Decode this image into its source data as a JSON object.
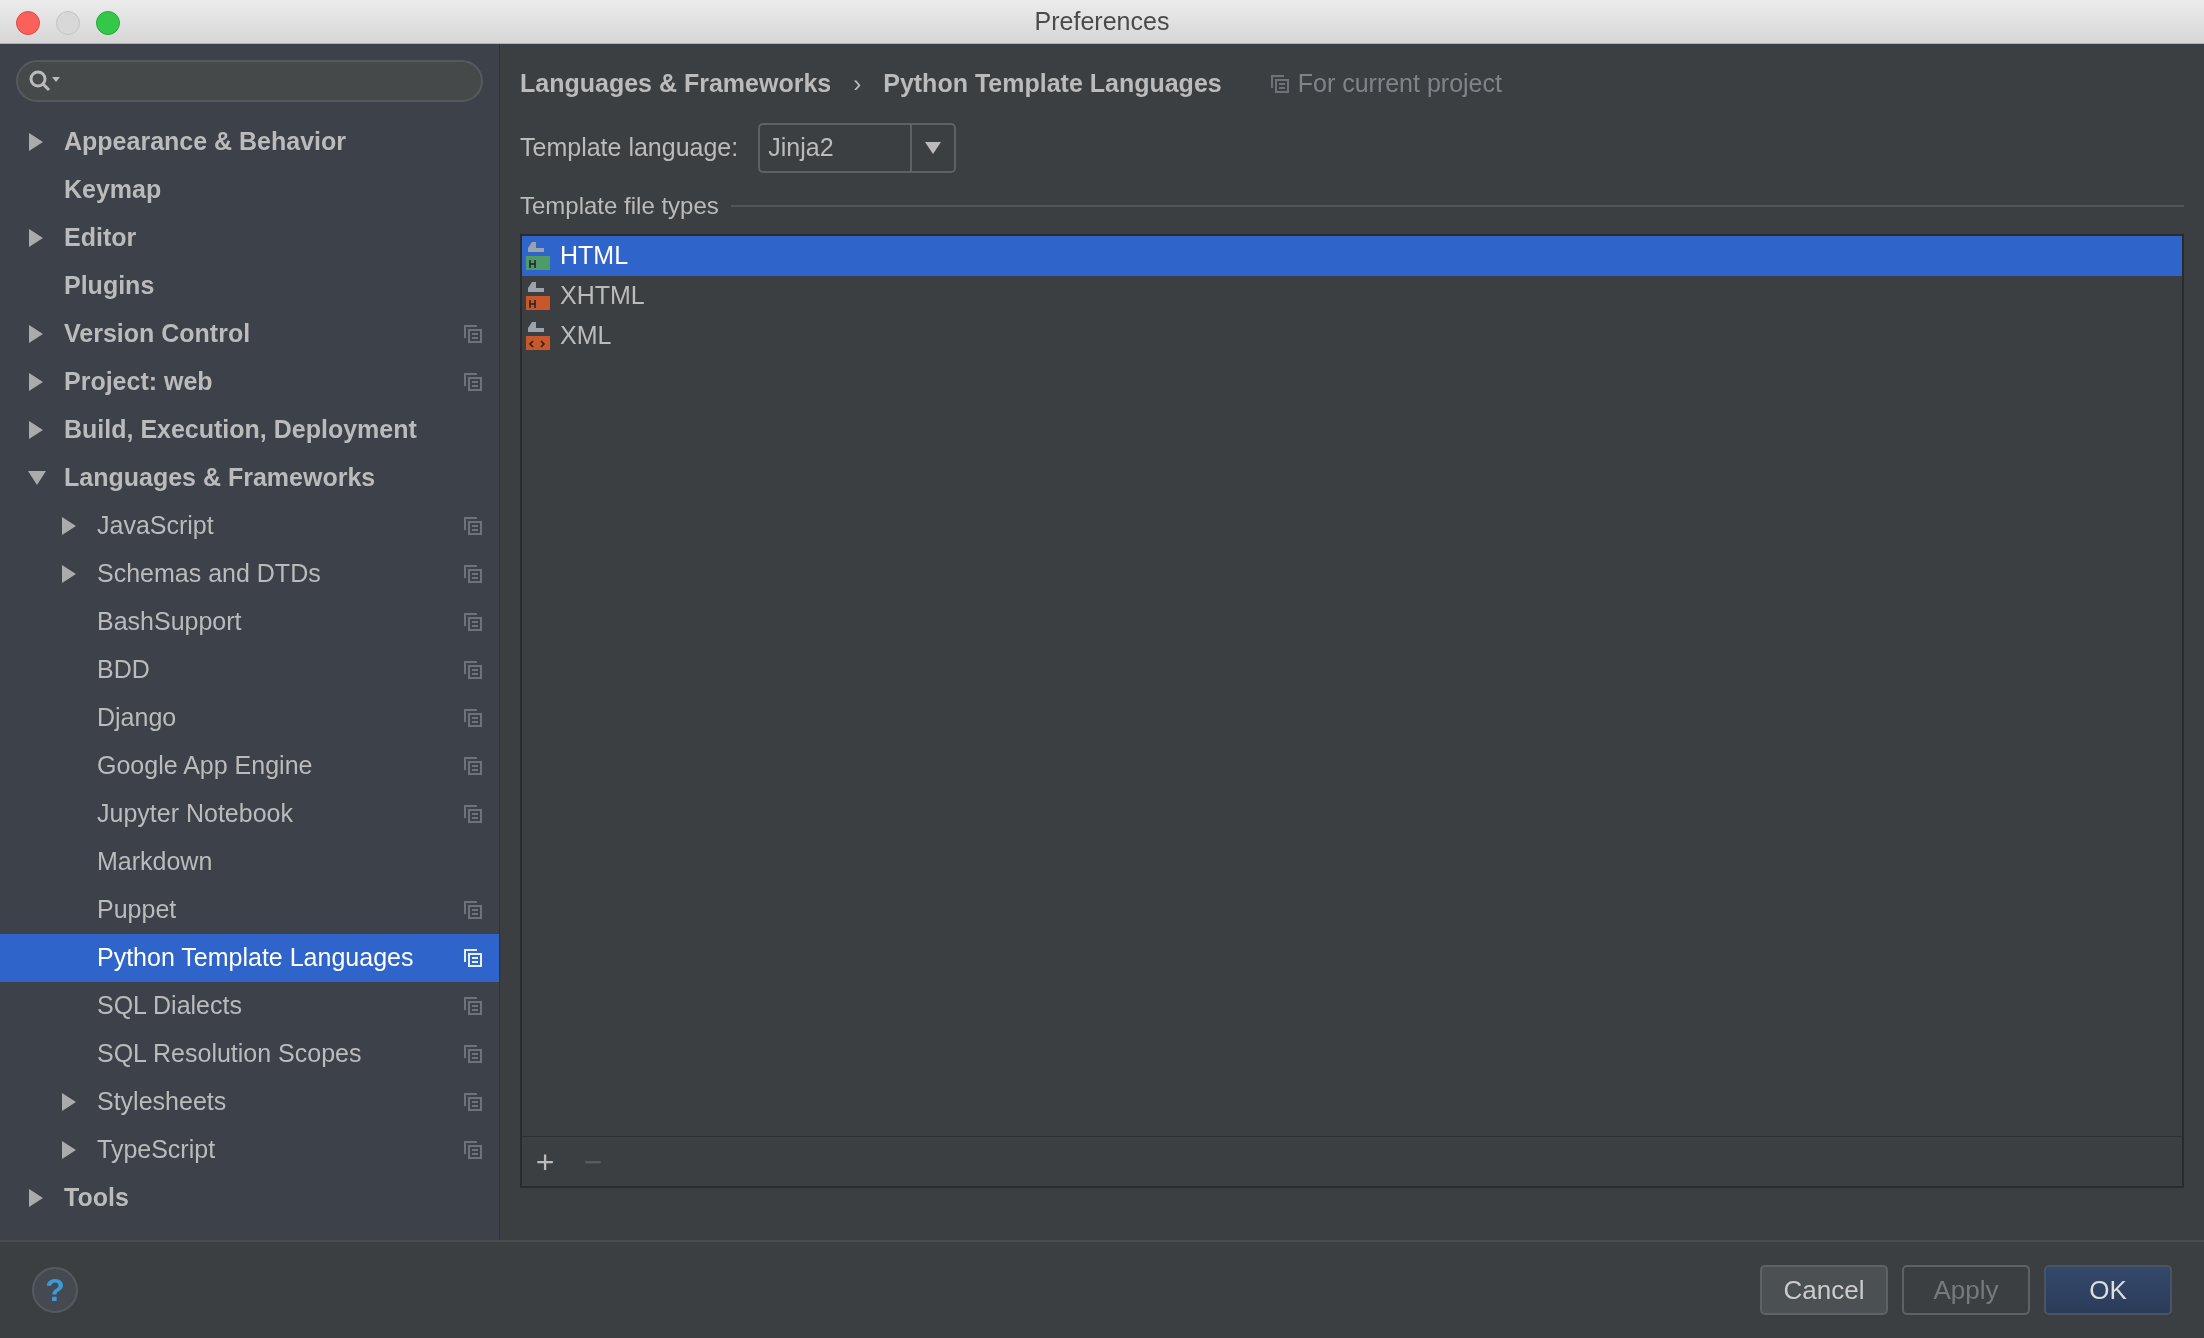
{
  "window": {
    "title": "Preferences"
  },
  "sidebar": {
    "items": [
      {
        "label": "Appearance & Behavior",
        "kind": "collapsed",
        "project_scope": false,
        "selected": false
      },
      {
        "label": "Keymap",
        "kind": "leaf",
        "project_scope": false,
        "selected": false
      },
      {
        "label": "Editor",
        "kind": "collapsed",
        "project_scope": false,
        "selected": false
      },
      {
        "label": "Plugins",
        "kind": "leaf",
        "project_scope": false,
        "selected": false
      },
      {
        "label": "Version Control",
        "kind": "collapsed",
        "project_scope": true,
        "selected": false
      },
      {
        "label": "Project: web",
        "kind": "collapsed",
        "project_scope": true,
        "selected": false
      },
      {
        "label": "Build, Execution, Deployment",
        "kind": "collapsed",
        "project_scope": false,
        "selected": false
      },
      {
        "label": "Languages & Frameworks",
        "kind": "expanded",
        "project_scope": false,
        "selected": false,
        "children": [
          {
            "label": "JavaScript",
            "kind": "collapsed",
            "project_scope": true,
            "selected": false
          },
          {
            "label": "Schemas and DTDs",
            "kind": "collapsed",
            "project_scope": true,
            "selected": false
          },
          {
            "label": "BashSupport",
            "kind": "leaf",
            "project_scope": true,
            "selected": false
          },
          {
            "label": "BDD",
            "kind": "leaf",
            "project_scope": true,
            "selected": false
          },
          {
            "label": "Django",
            "kind": "leaf",
            "project_scope": true,
            "selected": false
          },
          {
            "label": "Google App Engine",
            "kind": "leaf",
            "project_scope": true,
            "selected": false
          },
          {
            "label": "Jupyter Notebook",
            "kind": "leaf",
            "project_scope": true,
            "selected": false
          },
          {
            "label": "Markdown",
            "kind": "leaf",
            "project_scope": false,
            "selected": false
          },
          {
            "label": "Puppet",
            "kind": "leaf",
            "project_scope": true,
            "selected": false
          },
          {
            "label": "Python Template Languages",
            "kind": "leaf",
            "project_scope": true,
            "selected": true
          },
          {
            "label": "SQL Dialects",
            "kind": "leaf",
            "project_scope": true,
            "selected": false
          },
          {
            "label": "SQL Resolution Scopes",
            "kind": "leaf",
            "project_scope": true,
            "selected": false
          },
          {
            "label": "Stylesheets",
            "kind": "collapsed",
            "project_scope": true,
            "selected": false
          },
          {
            "label": "TypeScript",
            "kind": "collapsed",
            "project_scope": true,
            "selected": false
          }
        ]
      },
      {
        "label": "Tools",
        "kind": "collapsed",
        "project_scope": false,
        "selected": false
      }
    ]
  },
  "breadcrumbs": {
    "items": [
      "Languages & Frameworks",
      "Python Template Languages"
    ],
    "separator": "›",
    "scope": "For current project"
  },
  "template_language": {
    "label": "Template language:",
    "value": "Jinja2"
  },
  "file_types": {
    "title": "Template file types",
    "items": [
      {
        "label": "HTML",
        "kind": "html",
        "selected": true
      },
      {
        "label": "XHTML",
        "kind": "xhtml",
        "selected": false
      },
      {
        "label": "XML",
        "kind": "xml",
        "selected": false
      }
    ],
    "toolbar": [
      {
        "symbol": "+",
        "disabled": false
      },
      {
        "symbol": "−",
        "disabled": true
      }
    ]
  },
  "help": {
    "symbol": "?"
  },
  "buttons": [
    {
      "label": "Cancel",
      "kind": "normal"
    },
    {
      "label": "Apply",
      "kind": "disabled"
    },
    {
      "label": "OK",
      "kind": "default"
    }
  ]
}
